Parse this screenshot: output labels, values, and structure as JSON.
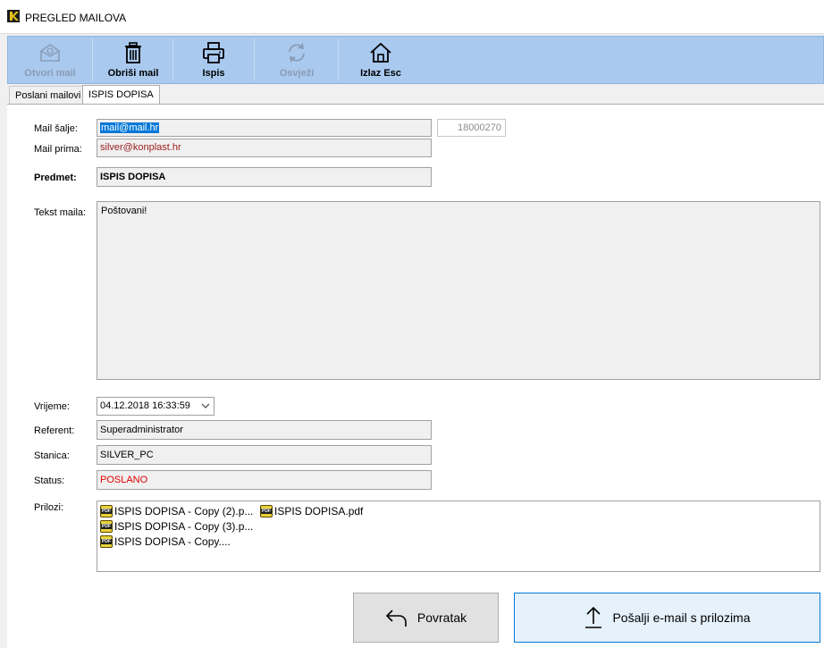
{
  "window": {
    "title": "PREGLED MAILOVA"
  },
  "toolbar": {
    "open_label": "Otvori mail",
    "delete_label": "Obriši mail",
    "print_label": "Ispis",
    "refresh_label": "Osvježi",
    "exit_label": "Izlaz Esc"
  },
  "tabs": [
    {
      "label": "Poslani mailovi"
    },
    {
      "label": "ISPIS DOPISA"
    }
  ],
  "form": {
    "sender_label": "Mail šalje:",
    "sender_value": "mail@mail.hr",
    "id_value": "18000270",
    "recipient_label": "Mail prima:",
    "recipient_value": "silver@konplast.hr",
    "subject_label": "Predmet:",
    "subject_value": "ISPIS DOPISA",
    "body_label": "Tekst maila:",
    "body_value": "Poštovani!",
    "time_label": "Vrijeme:",
    "time_value": "04.12.2018 16:33:59",
    "referent_label": "Referent:",
    "referent_value": "Superadministrator",
    "station_label": "Stanica:",
    "station_value": "SILVER_PC",
    "status_label": "Status:",
    "status_value": "POSLANO",
    "attachments_label": "Prilozi:",
    "attachments": [
      "ISPIS DOPISA - Copy (2).p...",
      "ISPIS DOPISA - Copy (3).p...",
      "ISPIS DOPISA - Copy....",
      "ISPIS DOPISA.pdf"
    ]
  },
  "buttons": {
    "back_label": "Povratak",
    "send_label": "Pošalji e-mail s prilozima"
  },
  "colors": {
    "toolbar_bg": "#a9c9ef",
    "selection": "#0078d7",
    "status_red": "#e00000",
    "recipient_text": "#9b1b1b"
  }
}
